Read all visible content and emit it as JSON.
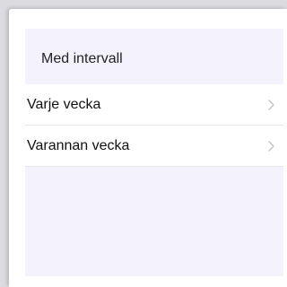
{
  "section": {
    "title": "Med intervall"
  },
  "items": [
    {
      "label": "Varje vecka",
      "icon": "chevron-right-icon"
    },
    {
      "label": "Varannan vecka",
      "icon": "chevron-right-icon"
    }
  ],
  "colors": {
    "panel_background": "#f4f2fc",
    "row_background": "#ffffff",
    "divider": "#e7e7ea",
    "chevron": "#c7c7cc"
  }
}
